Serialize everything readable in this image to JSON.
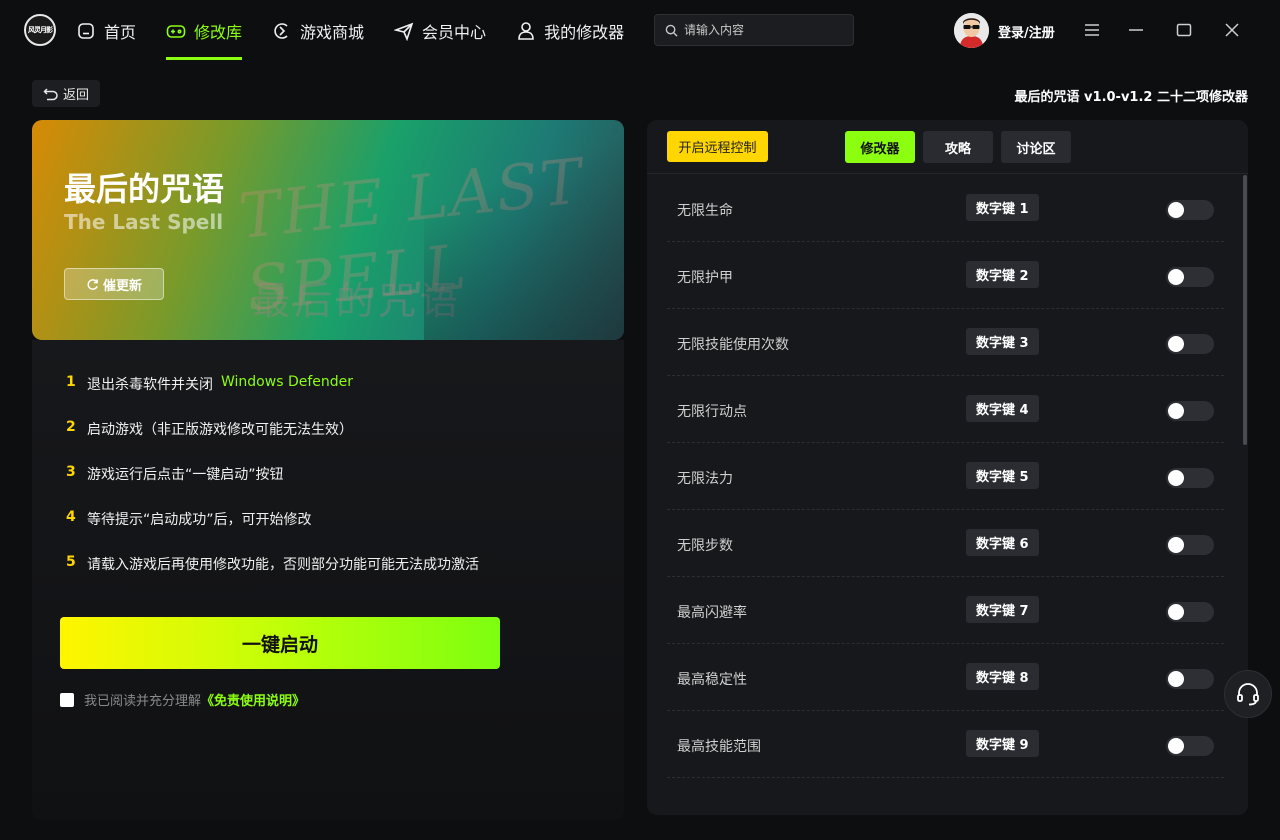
{
  "app": {
    "logo_text": "风灵月影"
  },
  "nav": {
    "items": [
      {
        "label": "首页",
        "icon": "home-icon"
      },
      {
        "label": "修改库",
        "icon": "gamepad-icon"
      },
      {
        "label": "游戏商城",
        "icon": "store-icon"
      },
      {
        "label": "会员中心",
        "icon": "paper-plane-icon"
      },
      {
        "label": "我的修改器",
        "icon": "user-icon"
      }
    ],
    "active_index": 1
  },
  "search": {
    "placeholder": "请输入内容",
    "value": ""
  },
  "user": {
    "login_label": "登录/注册"
  },
  "page": {
    "back_label": "返回",
    "trainer_title": "最后的咒语 v1.0-v1.2 二十二项修改器"
  },
  "banner": {
    "title_cn": "最后的咒语",
    "title_en": "The Last Spell",
    "update_label": "催更新"
  },
  "steps": [
    {
      "num": "1",
      "text": "退出杀毒软件并关闭",
      "highlight": "Windows Defender"
    },
    {
      "num": "2",
      "text": "启动游戏（非正版游戏修改可能无法生效）",
      "highlight": ""
    },
    {
      "num": "3",
      "text": "游戏运行后点击“一键启动”按钮",
      "highlight": ""
    },
    {
      "num": "4",
      "text": "等待提示“启动成功”后，可开始修改",
      "highlight": ""
    },
    {
      "num": "5",
      "text": "请载入游戏后再使用修改功能，否则部分功能可能无法成功激活",
      "highlight": ""
    }
  ],
  "start_button": "一键启动",
  "agreement": {
    "text": "我已阅读并充分理解",
    "link": "《免责使用说明》",
    "checked": false
  },
  "right_panel": {
    "remote_label": "开启远程控制",
    "tabs": [
      {
        "label": "修改器",
        "active": true
      },
      {
        "label": "攻略",
        "active": false
      },
      {
        "label": "讨论区",
        "active": false
      }
    ],
    "cheats": [
      {
        "label": "无限生命",
        "key": "数字键 1",
        "enabled": false
      },
      {
        "label": "无限护甲",
        "key": "数字键 2",
        "enabled": false
      },
      {
        "label": "无限技能使用次数",
        "key": "数字键 3",
        "enabled": false
      },
      {
        "label": "无限行动点",
        "key": "数字键 4",
        "enabled": false
      },
      {
        "label": "无限法力",
        "key": "数字键 5",
        "enabled": false
      },
      {
        "label": "无限步数",
        "key": "数字键 6",
        "enabled": false
      },
      {
        "label": "最高闪避率",
        "key": "数字键 7",
        "enabled": false
      },
      {
        "label": "最高稳定性",
        "key": "数字键 8",
        "enabled": false
      },
      {
        "label": "最高技能范围",
        "key": "数字键 9",
        "enabled": false
      }
    ]
  },
  "colors": {
    "accent_green": "#8cff10",
    "accent_yellow": "#ffd600",
    "background": "#0d0e10",
    "panel": "#17181b"
  }
}
